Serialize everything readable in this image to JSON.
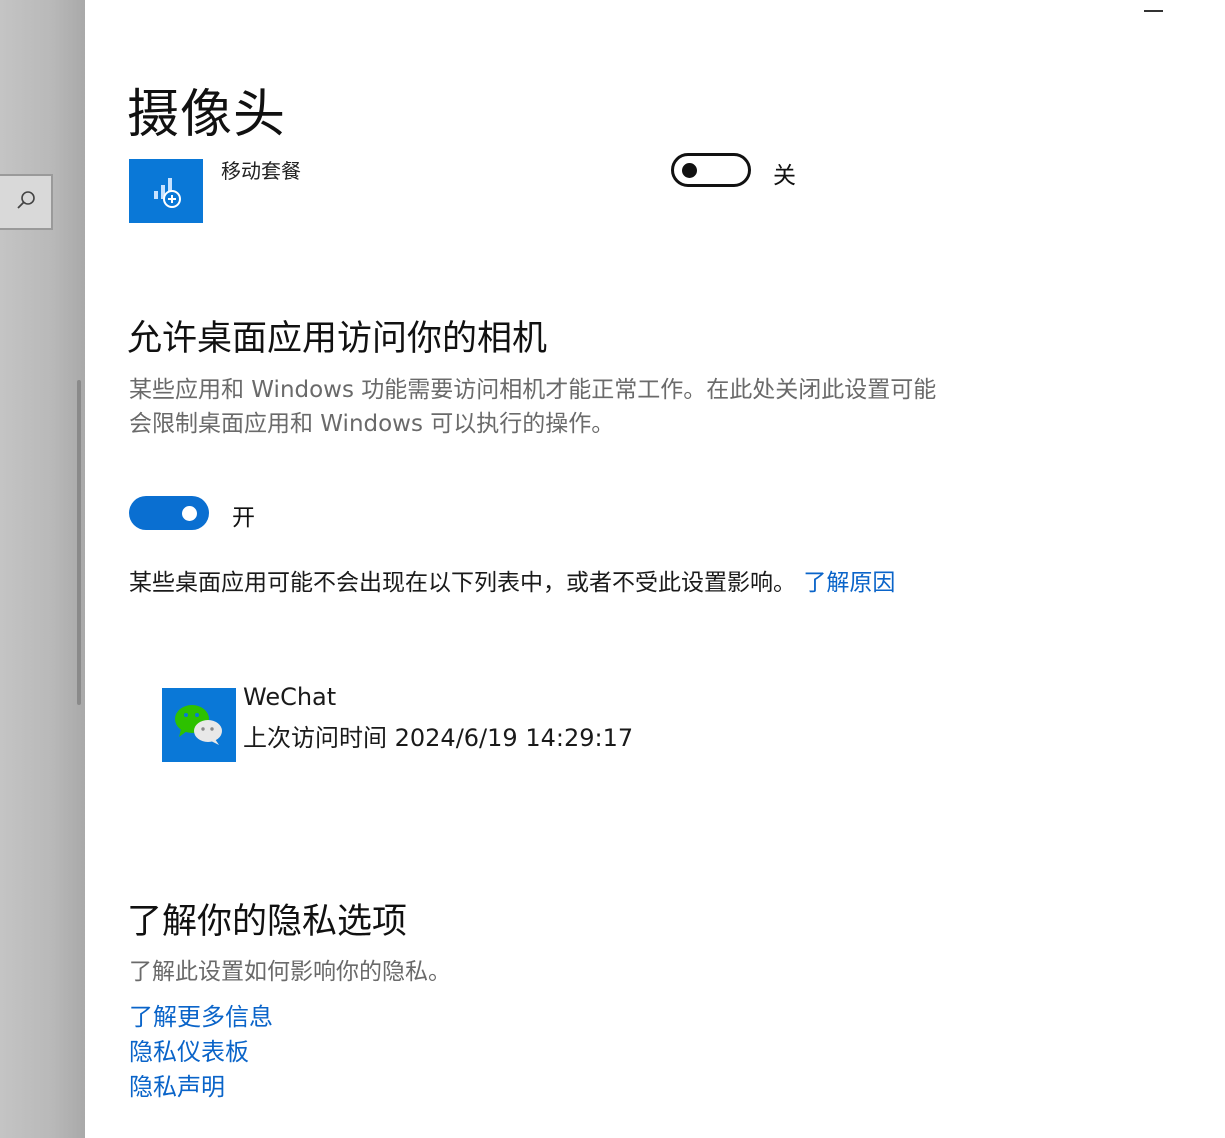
{
  "page": {
    "title": "摄像头"
  },
  "mobile_plan": {
    "name": "移动套餐",
    "state_label": "关"
  },
  "desktop_section": {
    "heading": "允许桌面应用访问你的相机",
    "description": "某些应用和 Windows 功能需要访问相机才能正常工作。在此处关闭此设置可能会限制桌面应用和 Windows 可以执行的操作。",
    "state_label": "开",
    "note": "某些桌面应用可能不会出现在以下列表中，或者不受此设置影响。",
    "note_link": "了解原因"
  },
  "apps": [
    {
      "name": "WeChat",
      "last_access": "上次访问时间 2024/6/19 14:29:17"
    }
  ],
  "privacy_section": {
    "heading": "了解你的隐私选项",
    "description": "了解此设置如何影响你的隐私。",
    "links": [
      "了解更多信息",
      "隐私仪表板",
      "隐私声明"
    ]
  },
  "colors": {
    "accent": "#0a6fd1",
    "link": "#0a64c9",
    "tile": "#0a78d7"
  }
}
